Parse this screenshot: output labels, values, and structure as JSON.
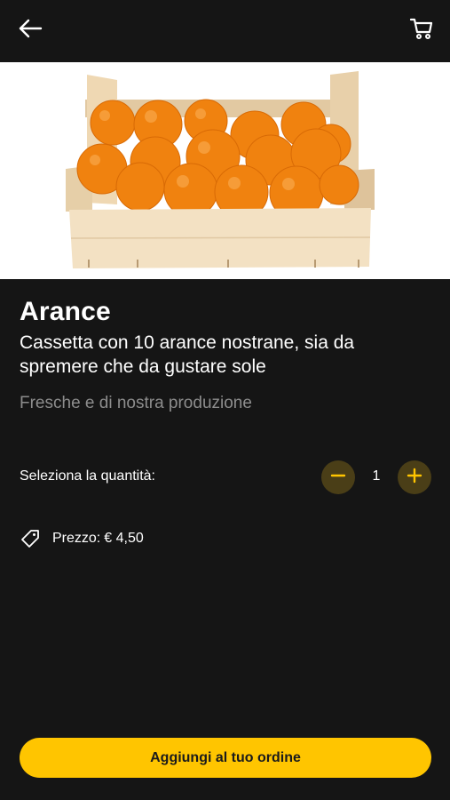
{
  "header": {
    "back_icon": "arrow-left-icon",
    "cart_icon": "cart-icon"
  },
  "product": {
    "name": "Arance",
    "description": "Cassetta con 10 arance nostrane, sia da spremere che da gustare sole",
    "note": "Fresche e di nostra produzione",
    "image": "crate-of-oranges"
  },
  "quantity": {
    "label": "Seleziona la quantità:",
    "value": "1",
    "minus_icon": "minus-icon",
    "plus_icon": "plus-icon"
  },
  "price": {
    "icon": "price-tag-icon",
    "label": "Prezzo:",
    "value": "€ 4,50"
  },
  "cta": {
    "label": "Aggiungi al tuo ordine"
  },
  "colors": {
    "background": "#151515",
    "accent": "#ffc500",
    "qty_button_bg": "#4a3e17",
    "muted_text": "#8d8d8d"
  }
}
